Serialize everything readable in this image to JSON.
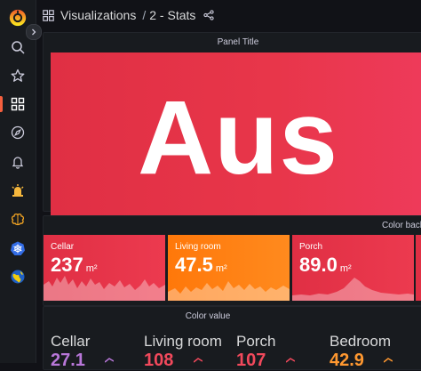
{
  "breadcrumb": {
    "section": "Visualizations",
    "separator": "/",
    "dashboard": "2 - Stats"
  },
  "panels": {
    "top": {
      "title": "Panel Title",
      "value": "Aus"
    },
    "color_background": {
      "title": "Color back",
      "tiles": [
        {
          "name": "Cellar",
          "value": "237",
          "unit": "m²",
          "color": "#e02f44"
        },
        {
          "name": "Living room",
          "value": "47.5",
          "unit": "m²",
          "color": "#ff780a"
        },
        {
          "name": "Porch",
          "value": "89.0",
          "unit": "m²",
          "color": "#e02f44"
        }
      ]
    },
    "color_value": {
      "title": "Color value",
      "items": [
        {
          "name": "Cellar",
          "value": "27.1",
          "color": "#b877d9"
        },
        {
          "name": "Living room",
          "value": "108",
          "color": "#f2495c"
        },
        {
          "name": "Porch",
          "value": "107",
          "color": "#f2495c"
        },
        {
          "name": "Bedroom",
          "value": "42.9",
          "color": "#ff9830"
        }
      ]
    }
  },
  "icons": {
    "sidebar": [
      "grafana-logo-icon",
      "search-icon",
      "star-icon",
      "dashboards-icon",
      "explore-icon",
      "alerting-icon",
      "alarm-icon",
      "ml-brain-icon",
      "kubernetes-icon",
      "globe-icon"
    ],
    "topbar": [
      "dashboard-grid-icon",
      "share-icon"
    ]
  },
  "colors": {
    "accent": "#f55f3e",
    "red": "#e02f44",
    "orange": "#ff780a"
  }
}
